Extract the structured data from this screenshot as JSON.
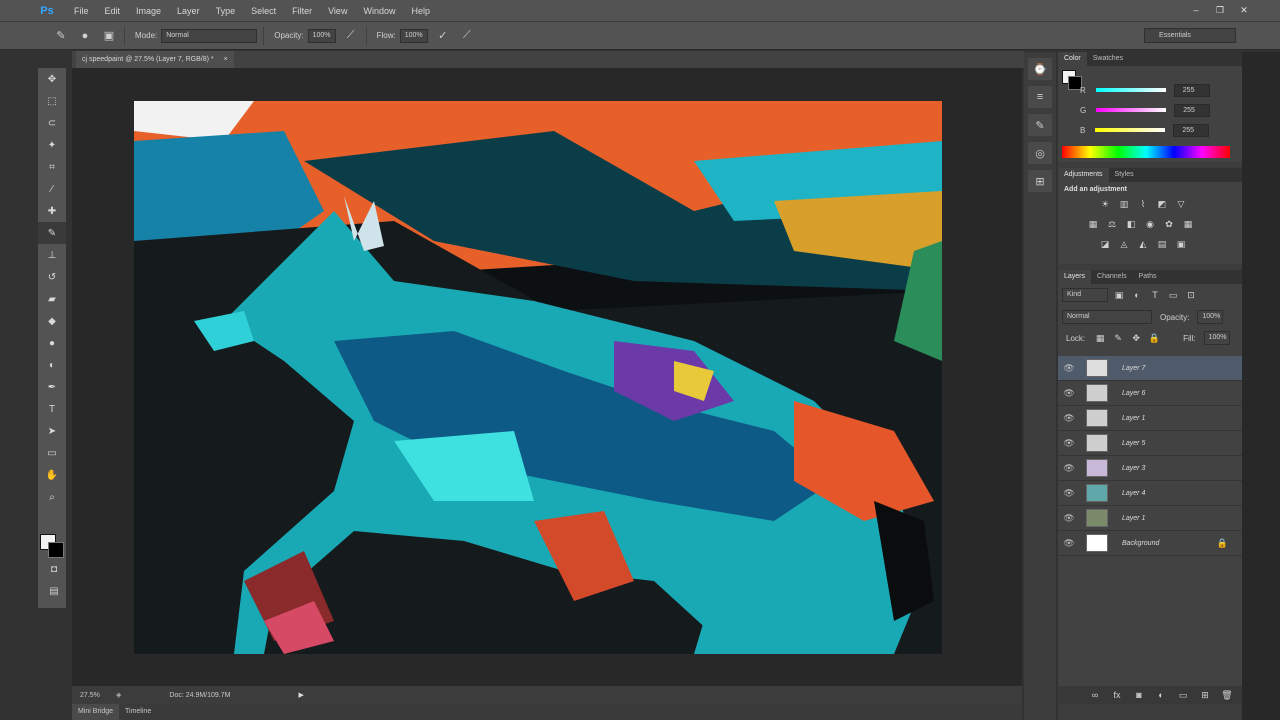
{
  "app": {
    "logo": "Ps",
    "menu": [
      "File",
      "Edit",
      "Image",
      "Layer",
      "Type",
      "Select",
      "Filter",
      "View",
      "Window",
      "Help"
    ],
    "window_controls": [
      "–",
      "❐",
      "✕"
    ]
  },
  "options": {
    "mode_label": "Mode:",
    "mode_value": "Normal",
    "opacity_label": "Opacity:",
    "opacity_value": "100%",
    "flow_label": "Flow:",
    "flow_value": "100%",
    "workspace": "Essentials"
  },
  "document": {
    "tab_title": "cj speedpaint @ 27.5% (Layer 7, RGB/8) *",
    "zoom": "27.5%",
    "doc_info": "Doc: 24.9M/109.7M"
  },
  "bottom_tabs": [
    "Mini Bridge",
    "Timeline"
  ],
  "color_panel": {
    "tabs": [
      "Color",
      "Swatches"
    ],
    "channels": [
      {
        "label": "R",
        "value": "255",
        "color": "#ff4040"
      },
      {
        "label": "G",
        "value": "255",
        "color": "#d040ff"
      },
      {
        "label": "B",
        "value": "255",
        "color": "#e8e830"
      }
    ]
  },
  "adjustments_panel": {
    "tabs": [
      "Adjustments",
      "Styles"
    ],
    "heading": "Add an adjustment"
  },
  "layers_panel": {
    "tabs": [
      "Layers",
      "Channels",
      "Paths"
    ],
    "kind": "Kind",
    "blend_mode": "Normal",
    "opacity_label": "Opacity:",
    "opacity": "100%",
    "lock_label": "Lock:",
    "fill_label": "Fill:",
    "fill": "100%",
    "layers": [
      {
        "name": "Layer 7",
        "selected": true
      },
      {
        "name": "Layer 6",
        "selected": false
      },
      {
        "name": "Layer 1",
        "selected": false
      },
      {
        "name": "Layer 5",
        "selected": false
      },
      {
        "name": "Layer 3",
        "selected": false
      },
      {
        "name": "Layer 4",
        "selected": false
      },
      {
        "name": "Layer 1",
        "selected": false
      },
      {
        "name": "Background",
        "selected": false
      }
    ]
  },
  "colors": {
    "ui_dark": "#282828",
    "ui_panel": "#424242",
    "ui_bar": "#535353",
    "selection": "#4f5a6a",
    "accent": "#31a8ff"
  }
}
